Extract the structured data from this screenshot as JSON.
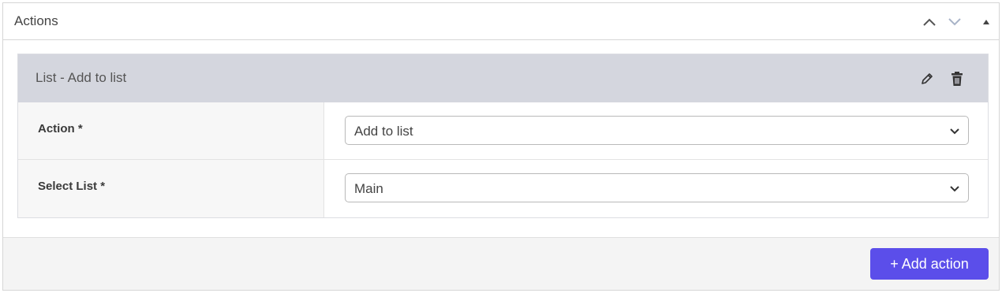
{
  "panel": {
    "title": "Actions"
  },
  "action_card": {
    "title": "List - Add to list"
  },
  "rows": [
    {
      "label": "Action *",
      "value": "Add to list"
    },
    {
      "label": "Select List *",
      "value": "Main"
    }
  ],
  "footer": {
    "add_action_label": "+ Add action"
  },
  "colors": {
    "accent": "#5b4eea",
    "card_header": "#d4d6de",
    "footer_bg": "#f4f4f4"
  },
  "icons": {
    "header": [
      "chevron-up-icon",
      "chevron-down-icon",
      "collapse-triangle-icon"
    ],
    "card": [
      "pencil-icon",
      "trash-icon"
    ],
    "select": "chevron-down-icon"
  }
}
